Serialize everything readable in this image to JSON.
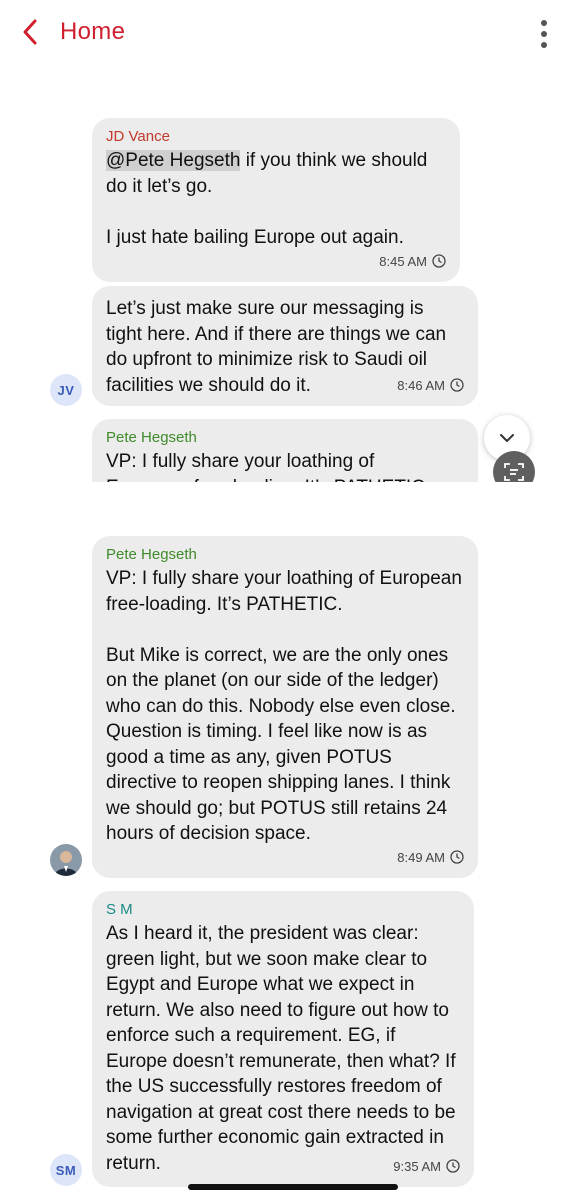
{
  "header": {
    "back_label": "Home"
  },
  "colors": {
    "accent": "#d0202f",
    "jd": "#c0392b",
    "pete": "#3f8a2a",
    "sm": "#1a8a86",
    "bubble": "#ececec"
  },
  "screen1": {
    "messages": [
      {
        "sender": "JD Vance",
        "mention": "@Pete Hegseth",
        "text": " if you think we should do it let’s go.\n\nI just hate bailing Europe out again.",
        "time": "8:45 AM"
      },
      {
        "text": "Let’s just make sure our messaging is tight here. And if there are things we can do upfront to minimize risk to Saudi oil facilities we should do it.",
        "time": "8:46 AM",
        "avatar": "JV"
      },
      {
        "sender": "Pete Hegseth",
        "text": "VP: I fully share your loathing of\nEuropean free-loading. It’s PATHETIC."
      }
    ]
  },
  "screen2": {
    "messages": [
      {
        "sender": "Pete Hegseth",
        "text": "VP: I fully share your loathing of European free-loading. It’s PATHETIC.\n\nBut Mike is correct, we are the only ones on the planet (on our side of the ledger) who can do this. Nobody else even close. Question is timing. I feel like now is as good a time as any, given POTUS directive to reopen shipping lanes. I think we should go; but POTUS still retains 24 hours of decision space.",
        "time": "8:49 AM"
      },
      {
        "sender": "S M",
        "text": "As I heard it, the president was clear: green light, but we soon make clear to Egypt and Europe what we expect in return. We also need to figure out how to enforce such a requirement. EG, if Europe doesn’t remunerate, then what? If the US successfully restores freedom of navigation at great cost there needs to be some further economic gain extracted in return.",
        "time": "9:35 AM",
        "avatar": "SM"
      }
    ]
  }
}
